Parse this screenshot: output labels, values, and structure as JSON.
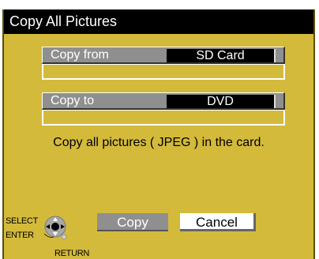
{
  "dialog": {
    "title": "Copy All Pictures",
    "copy_from": {
      "label": "Copy from",
      "value": "SD Card"
    },
    "copy_to": {
      "label": "Copy to",
      "value": "DVD"
    },
    "info": "Copy all pictures ( JPEG ) in the card."
  },
  "buttons": {
    "copy": "Copy",
    "cancel": "Cancel"
  },
  "remote_hint": {
    "select": "SELECT",
    "enter": "ENTER",
    "return": "RETURN",
    "icon": "remote-dpad-icon"
  },
  "colors": {
    "background": "#d4ba3a",
    "title_bar": "#000000",
    "field_gray": "#8f8f8f",
    "value_black": "#000000",
    "cancel_highlight": "#ffffff"
  }
}
